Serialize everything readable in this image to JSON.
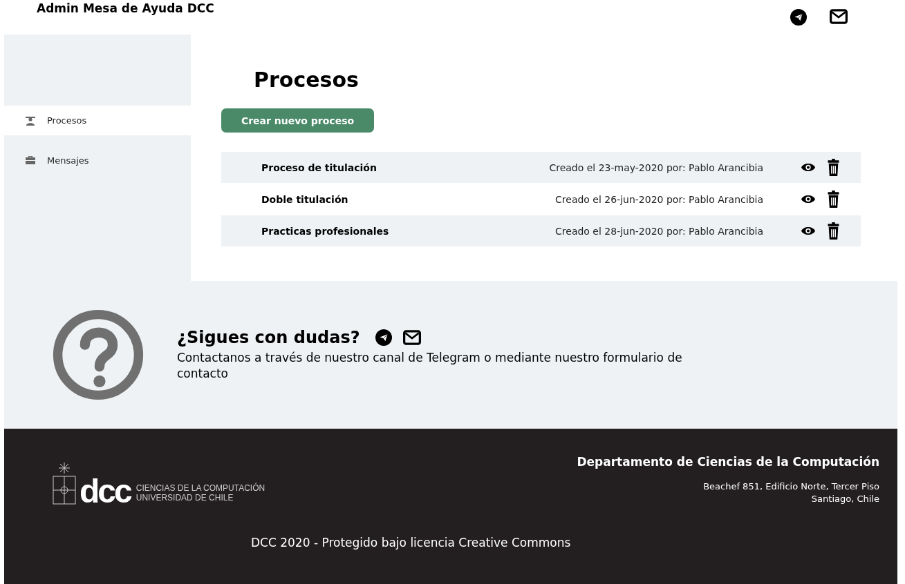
{
  "header": {
    "title": "Admin Mesa de Ayuda DCC"
  },
  "sidebar": {
    "items": [
      {
        "label": "Procesos",
        "selected": true
      },
      {
        "label": "Mensajes",
        "selected": false
      }
    ]
  },
  "main": {
    "title": "Procesos",
    "create_button": "Crear nuevo proceso",
    "processes": [
      {
        "name": "Proceso de titulación",
        "created": "Creado el 23-may-2020 por: Pablo Arancibia"
      },
      {
        "name": "Doble titulación",
        "created": "Creado el 26-jun-2020 por: Pablo Arancibia"
      },
      {
        "name": "Practicas profesionales",
        "created": "Creado el 28-jun-2020 por: Pablo Arancibia"
      }
    ]
  },
  "help": {
    "title": "¿Sigues con dudas?",
    "text": "Contactanos a través de nuestro canal de Telegram o mediante nuestro formulario de contacto"
  },
  "footer": {
    "logo_mark": "dcc",
    "logo_line_1": "CIENCIAS DE LA COMPUTACIÓN",
    "logo_line_2": "UNIVERSIDAD DE CHILE",
    "department": "Departamento de Ciencias de la Computación",
    "address_1": "Beachef 851, Edificio Norte, Tercer Piso",
    "address_2": "Santiago, Chile",
    "license": "DCC 2020 - Protegido bajo licencia Creative Commons"
  }
}
